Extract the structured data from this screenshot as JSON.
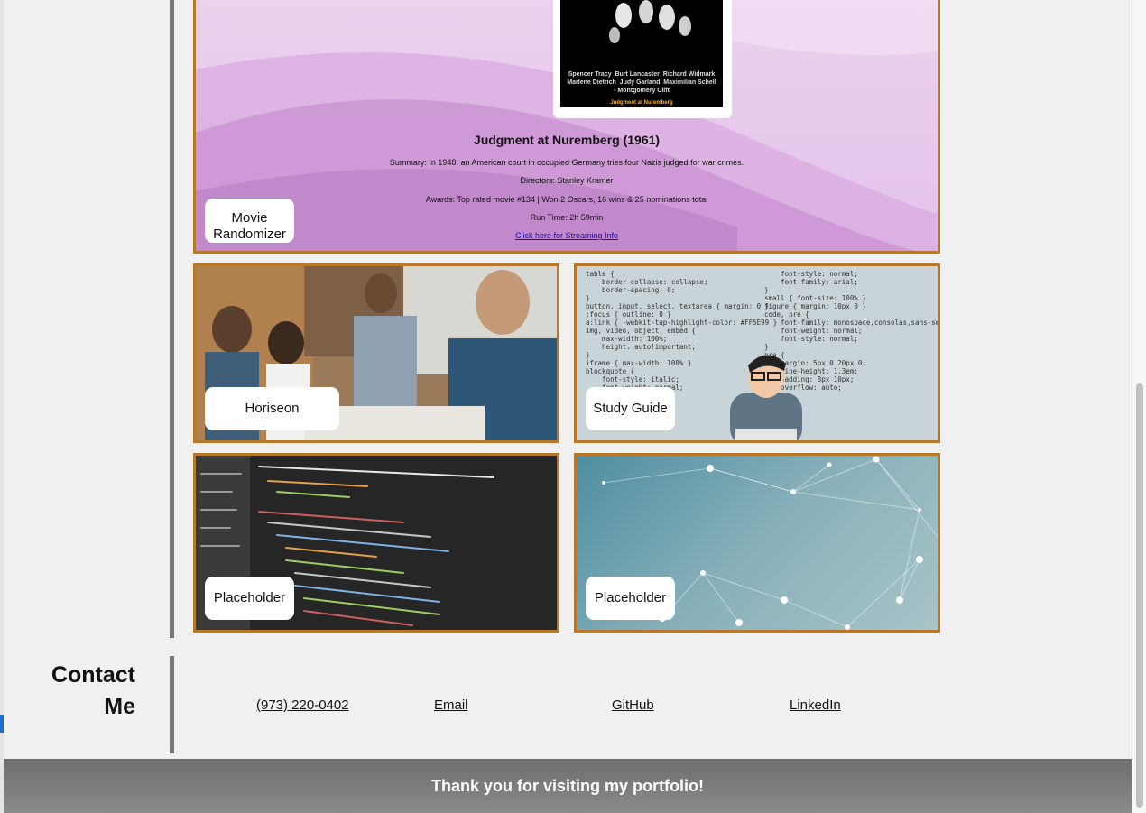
{
  "movie_card": {
    "poster_credits": "Spencer Tracy  Burt Lancaster  Richard Widmark\nMarlene Dietrich  Judy Garland  Maximilian Schell\n- Montgomery Clift",
    "poster_title": "Judgment at Nuremberg",
    "title": "Judgment at Nuremberg (1961)",
    "summary": "Summary: In 1948, an American court in occupied Germany tries four Nazis judged for war crimes.",
    "directors": "Directors: Stanley Kramer",
    "awards": "Awards: Top rated movie #134 | Won 2 Oscars, 16 wins & 25 nominations total",
    "runtime": "Run Time: 2h 59min",
    "streaming_link": "Click here for Streaming Info",
    "label": "Movie Randomizer"
  },
  "projects": [
    {
      "label": "Horiseon"
    },
    {
      "label": "Study Guide"
    },
    {
      "label": "Placeholder"
    },
    {
      "label": "Placeholder"
    }
  ],
  "study_code_left": "table {\n    border-collapse: collapse;\n    border-spacing: 0;\n}\nbutton, input, select, textarea { margin: 0 }\n:focus { outline: 0 }\na:link { -webkit-tap-highlight-color: #FF5E99 }\nimg, video, object, embed {\n    max-width: 100%;\n    height: auto!important;\n}\niframe { max-width: 100% }\nblockquote {\n    font-style: italic;\n    font-weight: normal;",
  "study_code_right": "    font-style: normal;\n    font-family: arial;\n}\nsmall { font-size: 100% }\nfigure { margin: 10px 0 }\ncode, pre {\n    font-family: monospace,consolas,sans-serif;\n    font-weight: normal;\n    font-style: normal;\n}\npre {\n    margin: 5px 0 20px 0;\n    line-height: 1.3em;\n    padding: 8px 10px;\n    overflow: auto;",
  "contact": {
    "title": "Contact Me",
    "phone": "(973) 220-0402",
    "email": "Email",
    "github": "GitHub",
    "linkedin": "LinkedIn"
  },
  "footer": "Thank you for visiting my portfolio!",
  "colors": {
    "card_border": "#b8782a",
    "footer_bg": "#767676",
    "page_bg": "#f0f0f0"
  }
}
